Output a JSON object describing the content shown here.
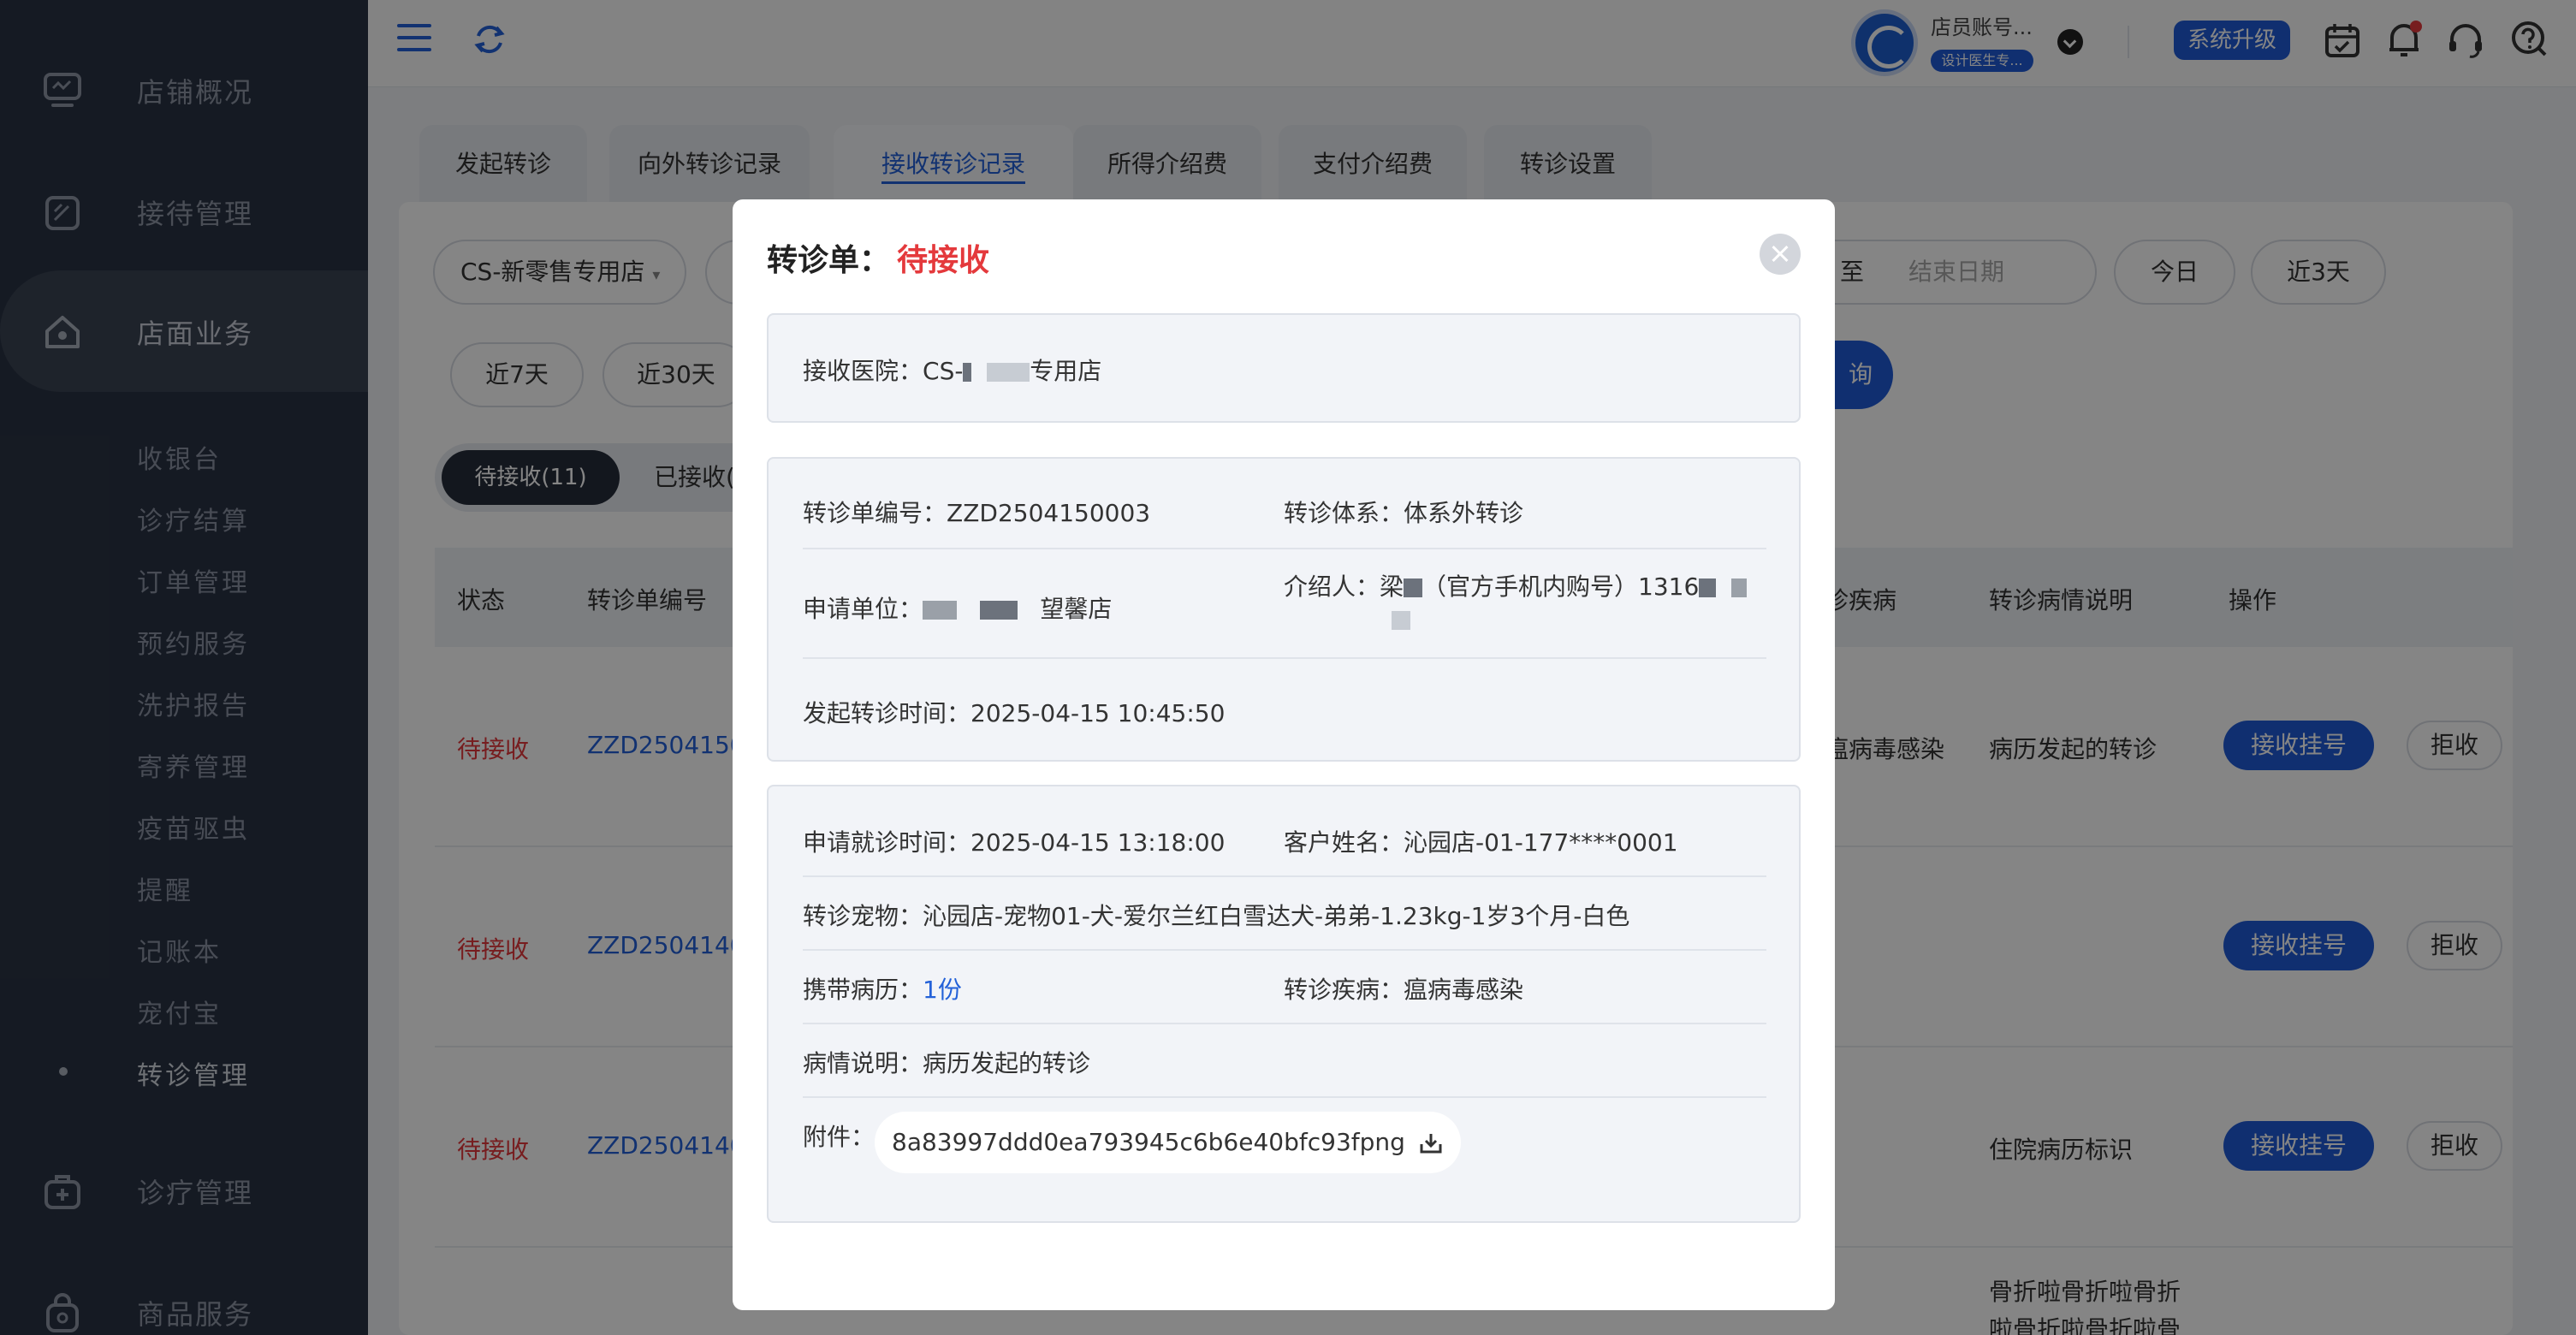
{
  "sidebar": {
    "main": [
      {
        "label": "店铺概况",
        "icon": "monitor-icon"
      },
      {
        "label": "接待管理",
        "icon": "clipboard-icon"
      },
      {
        "label": "店面业务",
        "icon": "home-icon"
      },
      {
        "label": "诊疗管理",
        "icon": "medical-kit-icon"
      },
      {
        "label": "商品服务",
        "icon": "shopping-bag-icon"
      }
    ],
    "sub": [
      "收银台",
      "诊疗结算",
      "订单管理",
      "预约服务",
      "洗护报告",
      "寄养管理",
      "疫苗驱虫",
      "提醒",
      "记账本",
      "宠付宝",
      "转诊管理"
    ]
  },
  "header": {
    "account_name": "店员账号...",
    "account_tag": "设计医生专...",
    "upgrade": "系统升级"
  },
  "tabs": [
    "发起转诊",
    "向外转诊记录",
    "接收转诊记录",
    "所得介绍费",
    "支付介绍费",
    "转诊设置"
  ],
  "filters": {
    "store": "CS-新零售专用店",
    "to": "至",
    "end_placeholder": "结束日期",
    "today": "今日",
    "last3": "近3天",
    "last7": "近7天",
    "last30": "近30天",
    "search": "询"
  },
  "segment": {
    "pending": "待接收(11)",
    "received": "已接收("
  },
  "table": {
    "headers": {
      "status": "状态",
      "no": "转诊单编号",
      "disease": "诊疾病",
      "desc": "转诊病情说明",
      "action": "操作"
    },
    "rows": [
      {
        "status": "待接收",
        "no": "ZZD2504150",
        "disease": "瘟病毒感染",
        "desc": "病历发起的转诊"
      },
      {
        "status": "待接收",
        "no": "ZZD2504140",
        "disease": "",
        "desc": ""
      },
      {
        "status": "待接收",
        "no": "ZZD2504140",
        "disease": "",
        "desc": "住院病历标识"
      }
    ],
    "row4_desc_1": "骨折啦骨折啦骨折",
    "row4_desc_2": "啦骨折啦骨折啦骨",
    "accept": "接收挂号",
    "reject": "拒收"
  },
  "modal": {
    "title": "转诊单：",
    "status": "待接收",
    "hospital_label": "接收医院：",
    "hospital_prefix": "CS-",
    "hospital_suffix": "专用店",
    "no_label": "转诊单编号：",
    "no": "ZZD2504150003",
    "system_label": "转诊体系：",
    "system": "体系外转诊",
    "unit_label": "申请单位：",
    "unit_suffix": "望馨店",
    "introducer_label": "介绍人：",
    "introducer_prefix": "梁",
    "introducer_mid": "（官方手机内购号）1316",
    "start_label": "发起转诊时间：",
    "start": "2025-04-15 10:45:50",
    "visit_label": "申请就诊时间：",
    "visit": "2025-04-15 13:18:00",
    "customer_label": "客户姓名：",
    "customer": "沁园店-01-177****0001",
    "pet_label": "转诊宠物：",
    "pet": "沁园店-宠物01-犬-爱尔兰红白雪达犬-弟弟-1.23kg-1岁3个月-白色",
    "records_label": "携带病历：",
    "records": "1份",
    "disease_label": "转诊疾病：",
    "disease": "瘟病毒感染",
    "desc_label": "病情说明：",
    "desc": "病历发起的转诊",
    "attach_label": "附件：",
    "attach": "8a83997ddd0ea793945c6b6e40bfc93fpng"
  }
}
